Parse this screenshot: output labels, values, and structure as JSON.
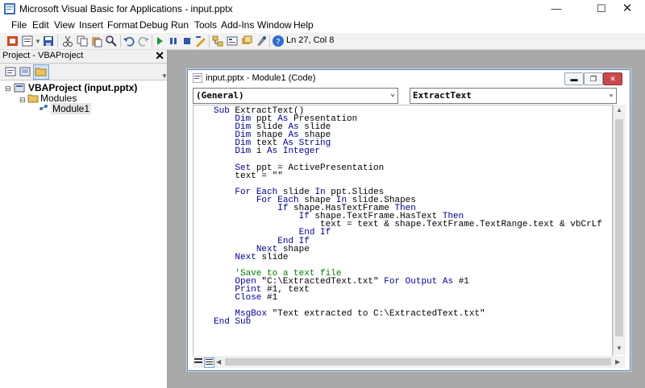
{
  "window": {
    "title": "Microsoft Visual Basic for Applications - input.pptx"
  },
  "menu": [
    "File",
    "Edit",
    "View",
    "Insert",
    "Format",
    "Debug",
    "Run",
    "Tools",
    "Add-Ins",
    "Window",
    "Help"
  ],
  "toolbar": {
    "status": "Ln 27, Col 8"
  },
  "project": {
    "header": "Project - VBAProject",
    "root": "VBAProject (input.pptx)",
    "folder": "Modules",
    "module": "Module1"
  },
  "code_window": {
    "title": "input.pptx - Module1 (Code)",
    "object_combo": "(General)",
    "proc_combo": "ExtractText"
  },
  "code_lines": [
    "Sub ExtractText()",
    "    Dim ppt As Presentation",
    "    Dim slide As slide",
    "    Dim shape As shape",
    "    Dim text As String",
    "    Dim i As Integer",
    "",
    "    Set ppt = ActivePresentation",
    "    text = \"\"",
    "",
    "    For Each slide In ppt.Slides",
    "        For Each shape In slide.Shapes",
    "            If shape.HasTextFrame Then",
    "                If shape.TextFrame.HasText Then",
    "                    text = text & shape.TextFrame.TextRange.text & vbCrLf",
    "                End If",
    "            End If",
    "        Next shape",
    "    Next slide",
    "",
    "    'Save to a text file",
    "    Open \"C:\\ExtractedText.txt\" For Output As #1",
    "    Print #1, text",
    "    Close #1",
    "",
    "    MsgBox \"Text extracted to C:\\ExtractedText.txt\"",
    "End Sub"
  ],
  "colors": {
    "keyword": "#00008b",
    "comment": "#008000",
    "workspace": "#a9a9a9"
  },
  "icons": [
    "vba-app-icon",
    "minimize-icon",
    "maximize-icon",
    "close-icon",
    "view-powerpoint-icon",
    "insert-module-icon",
    "save-icon",
    "cut-icon",
    "copy-icon",
    "paste-icon",
    "find-icon",
    "undo-icon",
    "redo-icon",
    "run-icon",
    "break-icon",
    "reset-icon",
    "design-mode-icon",
    "project-explorer-icon",
    "properties-icon",
    "object-browser-icon",
    "toolbox-icon",
    "help-icon",
    "view-code-icon",
    "view-object-icon",
    "toggle-folders-icon",
    "folder-icon",
    "module-icon"
  ]
}
